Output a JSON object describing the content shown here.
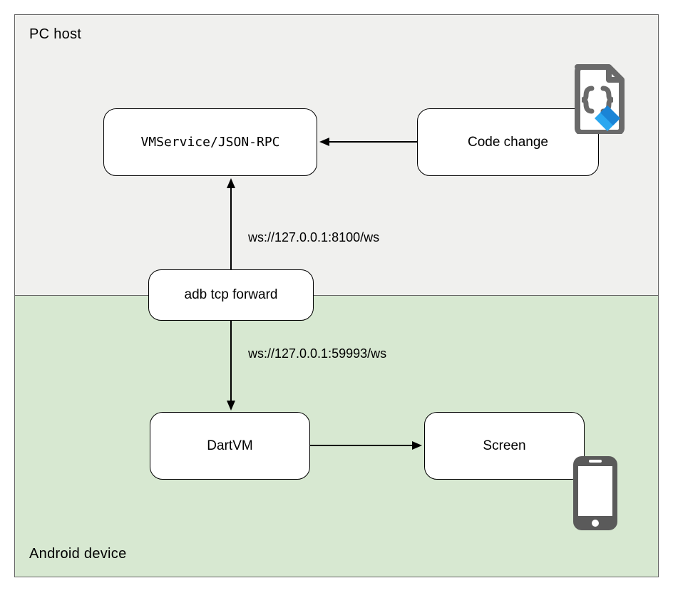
{
  "regions": {
    "top_label": "PC host",
    "bottom_label": "Android device"
  },
  "nodes": {
    "vmservice": "VMService/JSON-RPC",
    "code_change": "Code change",
    "adb": "adb tcp forward",
    "dartvm": "DartVM",
    "screen": "Screen"
  },
  "edges": {
    "adb_to_vmservice": "ws://127.0.0.1:8100/ws",
    "adb_to_dartvm": "ws://127.0.0.1:59993/ws"
  },
  "chart_data": {
    "type": "diagram",
    "title": "",
    "regions": [
      {
        "id": "pc_host",
        "label": "PC host"
      },
      {
        "id": "android_device",
        "label": "Android device"
      }
    ],
    "nodes": [
      {
        "id": "code_change",
        "label": "Code change",
        "region": "pc_host",
        "icon": "code-file"
      },
      {
        "id": "vmservice",
        "label": "VMService/JSON-RPC",
        "region": "pc_host"
      },
      {
        "id": "adb",
        "label": "adb tcp forward",
        "region": "boundary"
      },
      {
        "id": "dartvm",
        "label": "DartVM",
        "region": "android_device"
      },
      {
        "id": "screen",
        "label": "Screen",
        "region": "android_device",
        "icon": "phone"
      }
    ],
    "edges": [
      {
        "from": "code_change",
        "to": "vmservice",
        "label": ""
      },
      {
        "from": "adb",
        "to": "vmservice",
        "label": "ws://127.0.0.1:8100/ws"
      },
      {
        "from": "adb",
        "to": "dartvm",
        "label": "ws://127.0.0.1:59993/ws"
      },
      {
        "from": "dartvm",
        "to": "screen",
        "label": ""
      }
    ]
  }
}
